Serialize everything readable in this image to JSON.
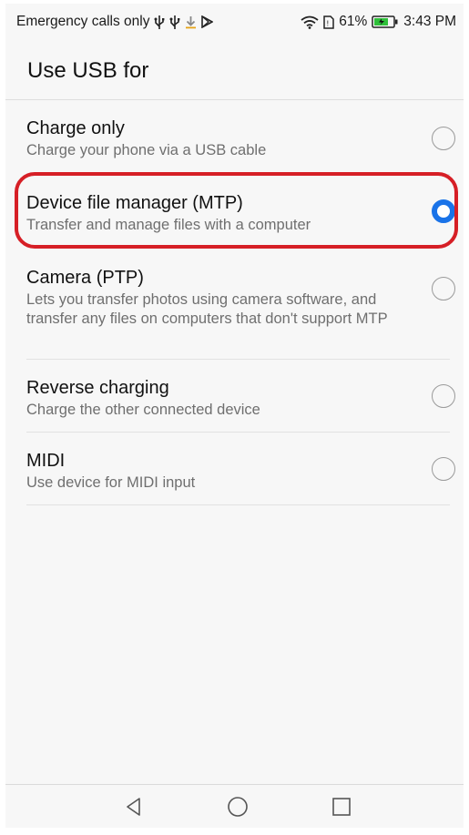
{
  "status_bar": {
    "carrier": "Emergency calls only",
    "battery": "61%",
    "time": "3:43 PM",
    "icons": [
      "usb-icon",
      "usb-icon",
      "download-icon",
      "play-store-icon",
      "wifi-icon",
      "sim-icon",
      "battery-charging-icon"
    ]
  },
  "page": {
    "title": "Use USB for"
  },
  "options": [
    {
      "title": "Charge only",
      "subtitle": "Charge your phone via a USB cable",
      "selected": false
    },
    {
      "title": "Device file manager (MTP)",
      "subtitle": "Transfer and manage files with a computer",
      "selected": true
    },
    {
      "title": "Camera (PTP)",
      "subtitle": "Lets you transfer photos using camera software, and transfer any files on computers that don't support MTP",
      "selected": false
    },
    {
      "title": "Reverse charging",
      "subtitle": "Charge the other connected device",
      "selected": false
    },
    {
      "title": "MIDI",
      "subtitle": "Use device for MIDI input",
      "selected": false
    }
  ],
  "colors": {
    "accent": "#1a73e8",
    "highlight": "#d61f26",
    "battery": "#2fbf3a"
  },
  "nav": {
    "icons": [
      "back-icon",
      "home-icon",
      "recents-icon"
    ]
  }
}
